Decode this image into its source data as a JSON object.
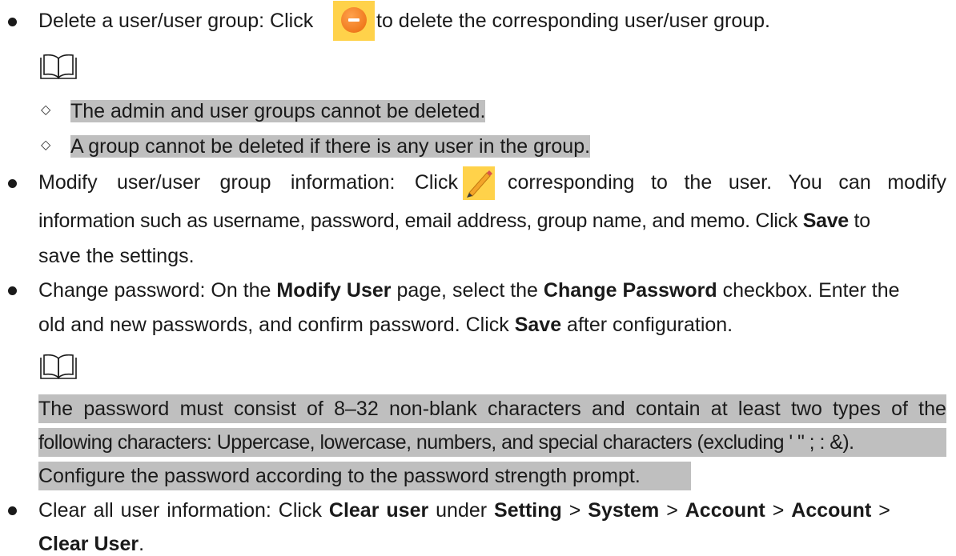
{
  "delete_item": {
    "before": "Delete a user/user group: Click ",
    "after": " to delete the corresponding user/user group.",
    "icon": "delete-minus-icon",
    "notes": [
      "The admin and user groups cannot be deleted.",
      "A group cannot be deleted if there is any user in the group."
    ]
  },
  "modify_item": {
    "line1_words": [
      "Modify",
      "user/user",
      "group",
      "information:",
      "Click"
    ],
    "line1_after_words": [
      "corresponding",
      "to",
      "the",
      "user.",
      "You",
      "can",
      "modify"
    ],
    "line2_text": "information such as username, password, email address, group name, and memo. Click ",
    "line2_bold": "Save",
    "line2_end": " to",
    "line3": "save the settings.",
    "icon": "edit-pencil-icon"
  },
  "password_item": {
    "line1_a": "Change password: On the ",
    "line1_b": "Modify User",
    "line1_c": " page, select the ",
    "line1_d": "Change Password",
    "line1_e": " checkbox. Enter the",
    "line2_a": "old and new passwords, and confirm password. Click ",
    "line2_b": "Save",
    "line2_c": " after configuration.",
    "note_line1": [
      "The",
      "password",
      "must",
      "consist",
      "of",
      "8–32",
      "non-blank",
      "characters",
      "and",
      "contain",
      "at",
      "least",
      "two",
      "types",
      "of",
      "the"
    ],
    "note_line2": "following characters: Uppercase, lowercase, numbers, and special characters (excluding ' \" ; : &).",
    "note_line3": "Configure the password according to the password strength prompt."
  },
  "clear_item": {
    "line1_a": "Clear all user information: Click ",
    "line1_b": "Clear user",
    "line1_c": " under ",
    "path": [
      "Setting",
      "System",
      "Account",
      "Account"
    ],
    "sep": ">",
    "line2_b": "Clear User",
    "line2_c": "."
  },
  "colors": {
    "highlight": "#bfbfbf",
    "icon_bg": "#ffd24a",
    "delete_icon": "#f07a1e"
  }
}
